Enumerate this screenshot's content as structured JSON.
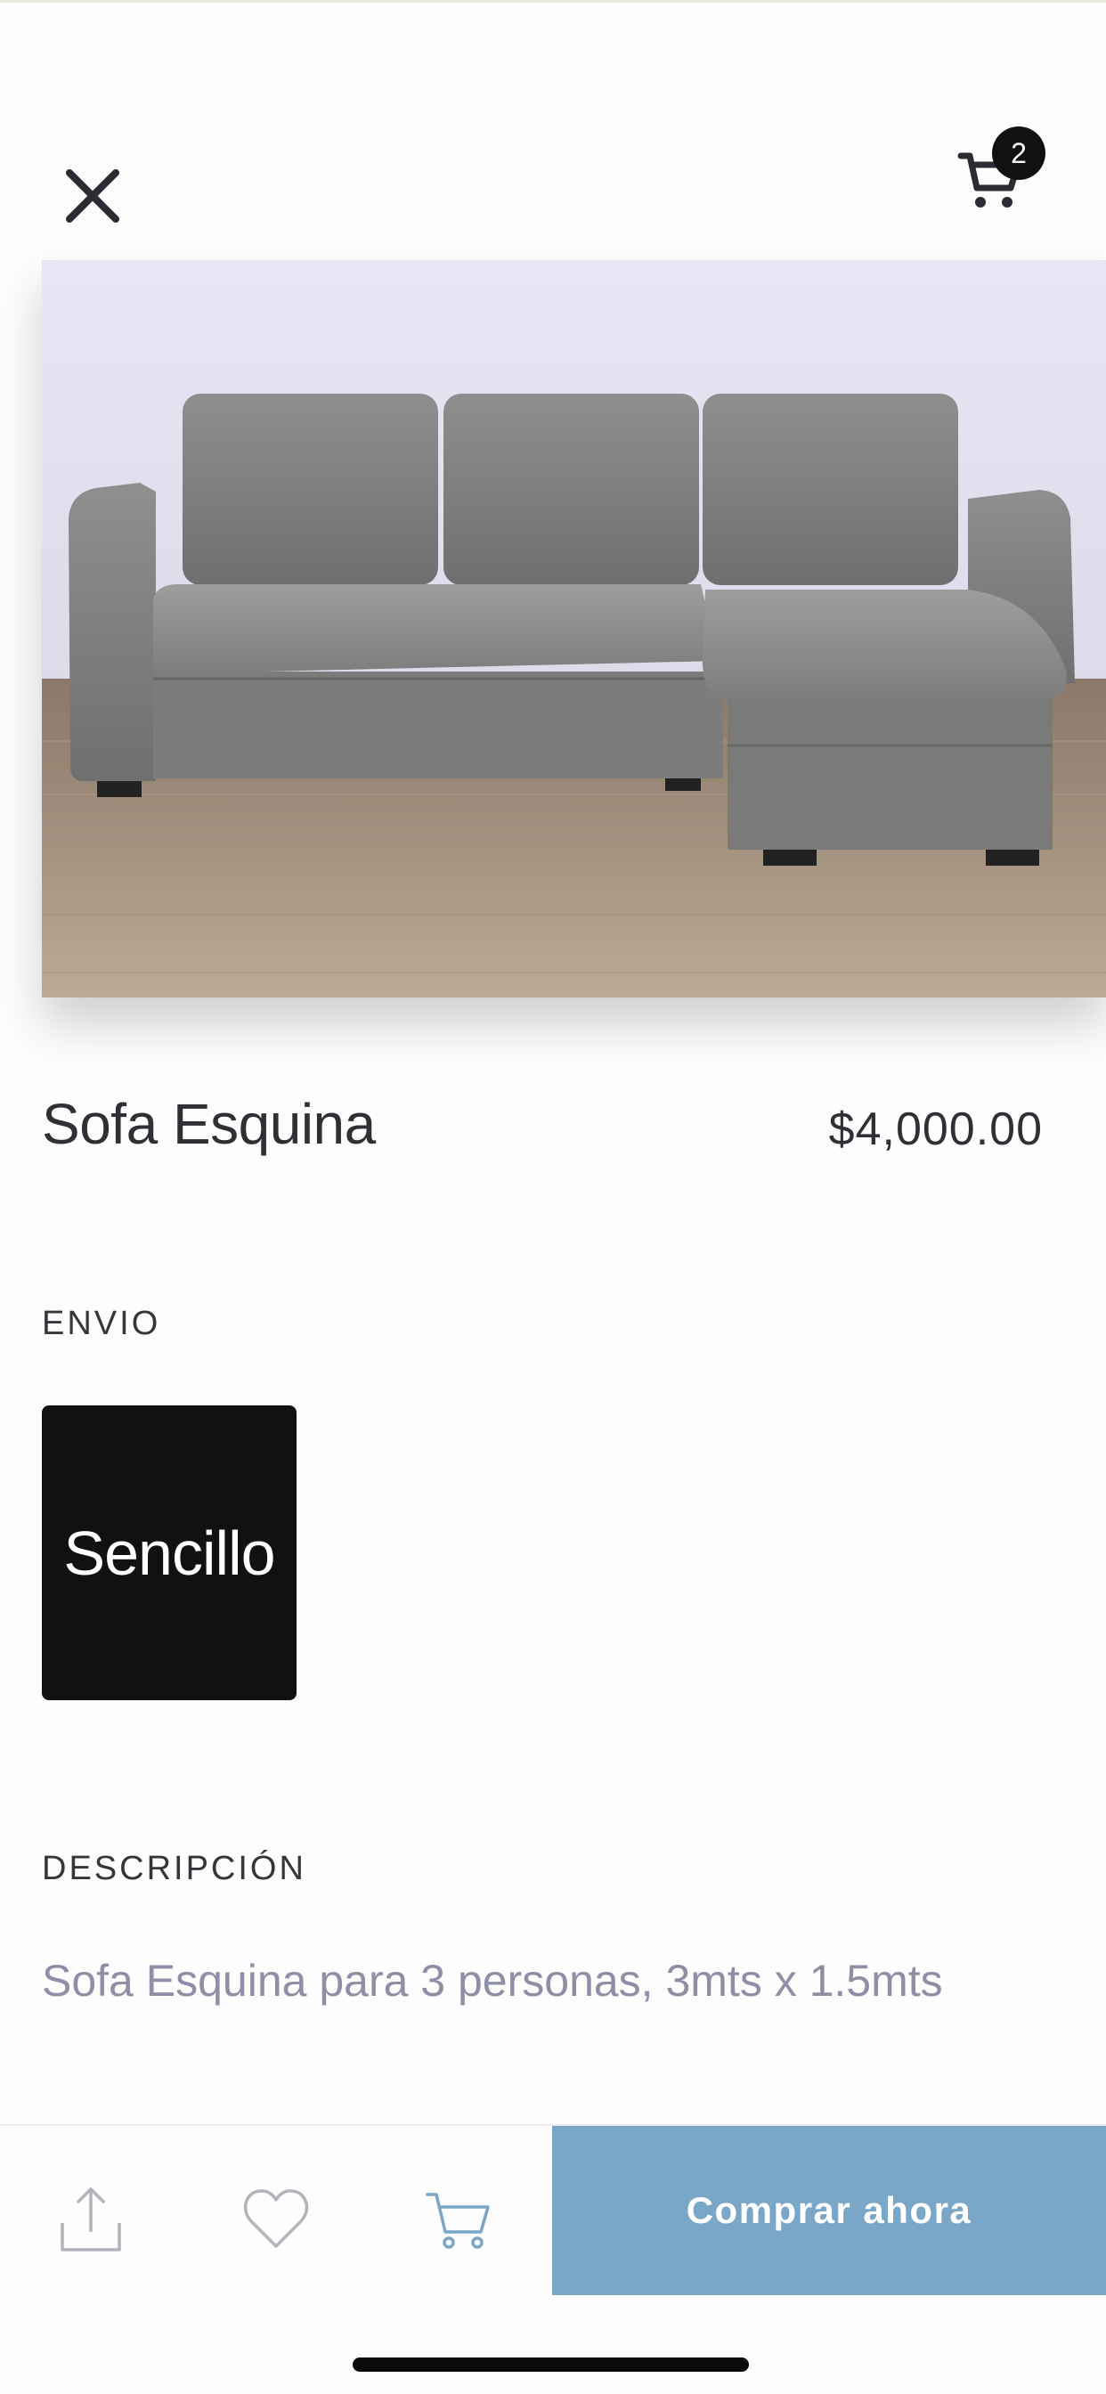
{
  "header": {
    "close_icon": "close-icon",
    "cart_icon": "cart-icon",
    "cart_count": "2"
  },
  "product": {
    "title": "Sofa Esquina",
    "price": "$4,000.00",
    "image_icon": "sofa-image"
  },
  "shipping": {
    "label": "ENVIO",
    "options": [
      {
        "label": "Sencillo",
        "selected": true
      }
    ]
  },
  "description": {
    "label": "DESCRIPCIÓN",
    "text": "Sofa Esquina para 3 personas, 3mts x 1.5mts"
  },
  "bottom_bar": {
    "share_icon": "share-icon",
    "favorite_icon": "heart-icon",
    "cart_icon": "cart-icon",
    "buy_label": "Comprar ahora"
  },
  "colors": {
    "accent": "#7aa7c7",
    "option_bg": "#111111",
    "description_text": "#8e8fa6"
  }
}
